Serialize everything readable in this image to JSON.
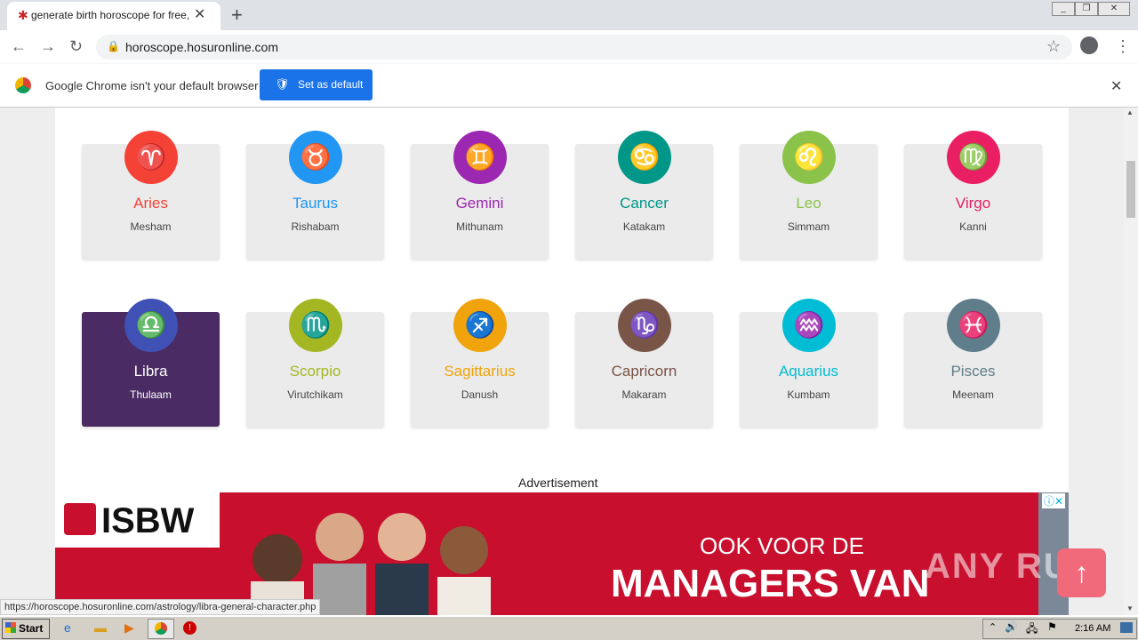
{
  "browser": {
    "tab_title": "generate birth horoscope for free, g",
    "url": "horoscope.hosuronline.com",
    "infobar_text": "Google Chrome isn't your default browser",
    "set_default_label": "Set as default",
    "status_url": "https://horoscope.hosuronline.com/astrology/libra-general-character.php"
  },
  "signs": [
    {
      "name": "Aries",
      "sub": "Mesham",
      "color": "#f44336",
      "glyph": "♈"
    },
    {
      "name": "Taurus",
      "sub": "Rishabam",
      "color": "#2196f3",
      "glyph": "♉"
    },
    {
      "name": "Gemini",
      "sub": "Mithunam",
      "color": "#9c27b0",
      "glyph": "♊"
    },
    {
      "name": "Cancer",
      "sub": "Katakam",
      "color": "#009688",
      "glyph": "♋"
    },
    {
      "name": "Leo",
      "sub": "Simmam",
      "color": "#8bc34a",
      "glyph": "♌"
    },
    {
      "name": "Virgo",
      "sub": "Kanni",
      "color": "#e91e63",
      "glyph": "♍"
    },
    {
      "name": "Libra",
      "sub": "Thulaam",
      "color": "#3f51b5",
      "glyph": "♎"
    },
    {
      "name": "Scorpio",
      "sub": "Virutchikam",
      "color": "#a4b723",
      "glyph": "♏"
    },
    {
      "name": "Sagittarius",
      "sub": "Danush",
      "color": "#f0a30a",
      "glyph": "♐"
    },
    {
      "name": "Capricorn",
      "sub": "Makaram",
      "color": "#795548",
      "glyph": "♑"
    },
    {
      "name": "Aquarius",
      "sub": "Kumbam",
      "color": "#00bcd4",
      "glyph": "♒"
    },
    {
      "name": "Pisces",
      "sub": "Meenam",
      "color": "#607d8b",
      "glyph": "♓"
    }
  ],
  "active_sign": "Libra",
  "advertisement_label": "Advertisement",
  "ad": {
    "logo_text": "ISBW",
    "line1": "OOK VOOR DE",
    "line2": "MANAGERS VAN"
  },
  "watermark": "ANY RUN",
  "taskbar": {
    "start_label": "Start",
    "clock": "2:16 AM"
  }
}
